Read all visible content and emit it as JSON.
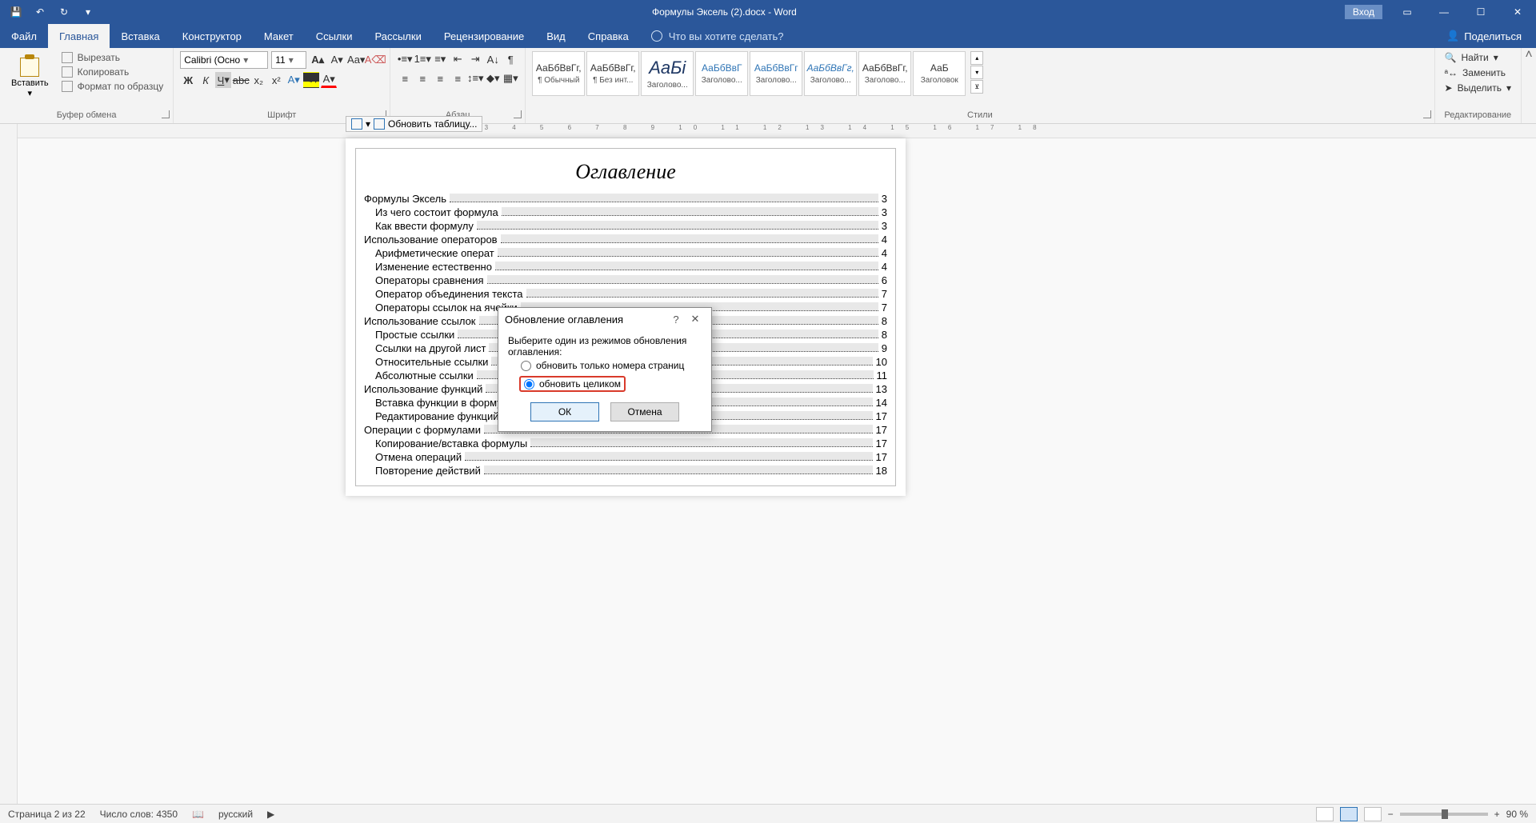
{
  "titlebar": {
    "document_title": "Формулы Эксель (2).docx - Word",
    "login": "Вход"
  },
  "tabs": {
    "file": "Файл",
    "home": "Главная",
    "insert": "Вставка",
    "design": "Конструктор",
    "layout": "Макет",
    "references": "Ссылки",
    "mailings": "Рассылки",
    "review": "Рецензирование",
    "view": "Вид",
    "help": "Справка",
    "tell_me": "Что вы хотите сделать?",
    "share": "Поделиться"
  },
  "ribbon": {
    "clipboard": {
      "paste": "Вставить",
      "cut": "Вырезать",
      "copy": "Копировать",
      "format_painter": "Формат по образцу",
      "label": "Буфер обмена"
    },
    "font": {
      "name": "Calibri (Осно",
      "size": "11",
      "label": "Шрифт",
      "bold": "Ж",
      "italic": "К",
      "underline": "Ч"
    },
    "paragraph": {
      "label": "Абзац"
    },
    "styles": {
      "label": "Стили",
      "items": [
        {
          "preview": "АаБбВвГг,",
          "name": "¶ Обычный"
        },
        {
          "preview": "АаБбВвГг,",
          "name": "¶ Без инт..."
        },
        {
          "preview": "АаБі",
          "name": "Заголово..."
        },
        {
          "preview": "АаБбВвГ",
          "name": "Заголово..."
        },
        {
          "preview": "АаБбВвГг",
          "name": "Заголово..."
        },
        {
          "preview": "АаБбВвГг,",
          "name": "Заголово..."
        },
        {
          "preview": "АаБбВвГг,",
          "name": "Заголово..."
        },
        {
          "preview": "АаБ",
          "name": "Заголовок"
        }
      ]
    },
    "editing": {
      "label": "Редактирование",
      "find": "Найти",
      "replace": "Заменить",
      "select": "Выделить"
    }
  },
  "toc_control": {
    "update": "Обновить таблицу..."
  },
  "toc": {
    "title": "Оглавление",
    "rows": [
      {
        "lvl": 1,
        "text": "Формулы Эксель",
        "pg": "3"
      },
      {
        "lvl": 2,
        "text": "Из чего состоит формула",
        "pg": "3"
      },
      {
        "lvl": 2,
        "text": "Как ввести формулу",
        "pg": "3"
      },
      {
        "lvl": 1,
        "text": "Использование операторов",
        "pg": "4"
      },
      {
        "lvl": 2,
        "text": "Арифметические операт",
        "pg": "4"
      },
      {
        "lvl": 2,
        "text": "Изменение естественно",
        "pg": "4"
      },
      {
        "lvl": 2,
        "text": "Операторы сравнения",
        "pg": "6"
      },
      {
        "lvl": 2,
        "text": "Оператор объединения текста",
        "pg": "7"
      },
      {
        "lvl": 2,
        "text": "Операторы ссылок на ячейки",
        "pg": "7"
      },
      {
        "lvl": 1,
        "text": "Использование ссылок",
        "pg": "8"
      },
      {
        "lvl": 2,
        "text": "Простые ссылки",
        "pg": "8"
      },
      {
        "lvl": 2,
        "text": "Ссылки на другой лист",
        "pg": "9"
      },
      {
        "lvl": 2,
        "text": "Относительные ссылки",
        "pg": "10"
      },
      {
        "lvl": 2,
        "text": "Абсолютные ссылки",
        "pg": "11"
      },
      {
        "lvl": 1,
        "text": "Использование функций",
        "pg": "13"
      },
      {
        "lvl": 2,
        "text": "Вставка функции в формулу с помощью мастера",
        "pg": "14"
      },
      {
        "lvl": 2,
        "text": "Редактирование функций с помощью мастера",
        "pg": "17"
      },
      {
        "lvl": 1,
        "text": "Операции с формулами",
        "pg": "17"
      },
      {
        "lvl": 2,
        "text": "Копирование/вставка формулы",
        "pg": "17"
      },
      {
        "lvl": 2,
        "text": "Отмена операций",
        "pg": "17"
      },
      {
        "lvl": 2,
        "text": "Повторение действий",
        "pg": "18"
      }
    ]
  },
  "dialog": {
    "title": "Обновление оглавления",
    "prompt": "Выберите один из режимов обновления оглавления:",
    "opt_pages": "обновить только номера страниц",
    "opt_all": "обновить целиком",
    "ok": "ОК",
    "cancel": "Отмена"
  },
  "status": {
    "page": "Страница 2 из 22",
    "words": "Число слов: 4350",
    "lang": "русский",
    "zoom": "90 %"
  }
}
